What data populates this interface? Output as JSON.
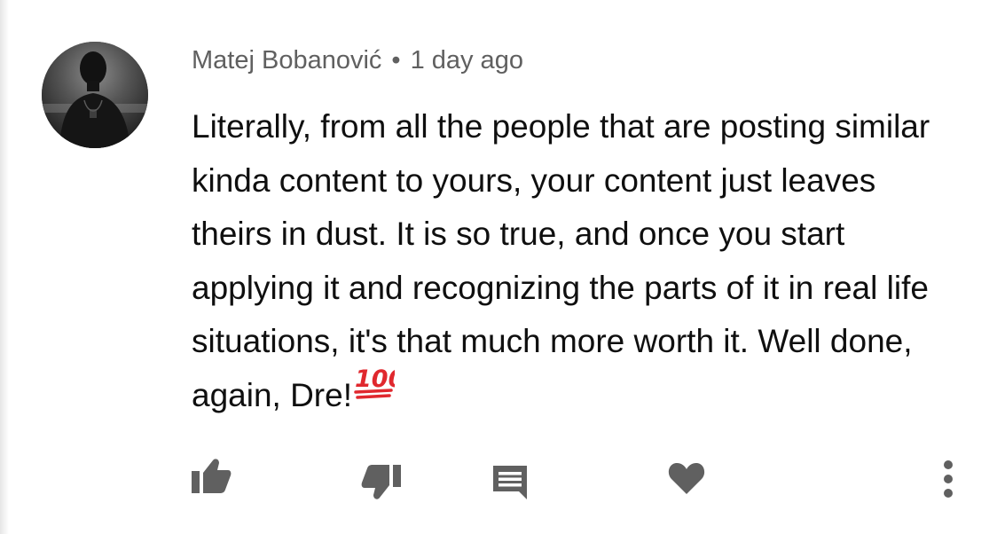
{
  "comment": {
    "author": "Matej Bobanović",
    "separator": "•",
    "timestamp": "1 day ago",
    "text": "Literally, from all the people that are posting similar kinda content to yours, your content just leaves theirs in dust. It is so true, and once you start applying it and recognizing the parts of it in real life situations, it's that much more worth it. Well done, again, Dre!",
    "emoji": "100-emoji"
  },
  "actions": {
    "like_icon": "thumbs-up-icon",
    "dislike_icon": "thumbs-down-icon",
    "reply_icon": "reply-comment-icon",
    "heart_icon": "heart-icon",
    "more_icon": "more-vertical-icon"
  },
  "colors": {
    "text": "#0f0f0f",
    "meta": "#606060",
    "icon": "#606060",
    "emoji_red": "#e0282e"
  }
}
